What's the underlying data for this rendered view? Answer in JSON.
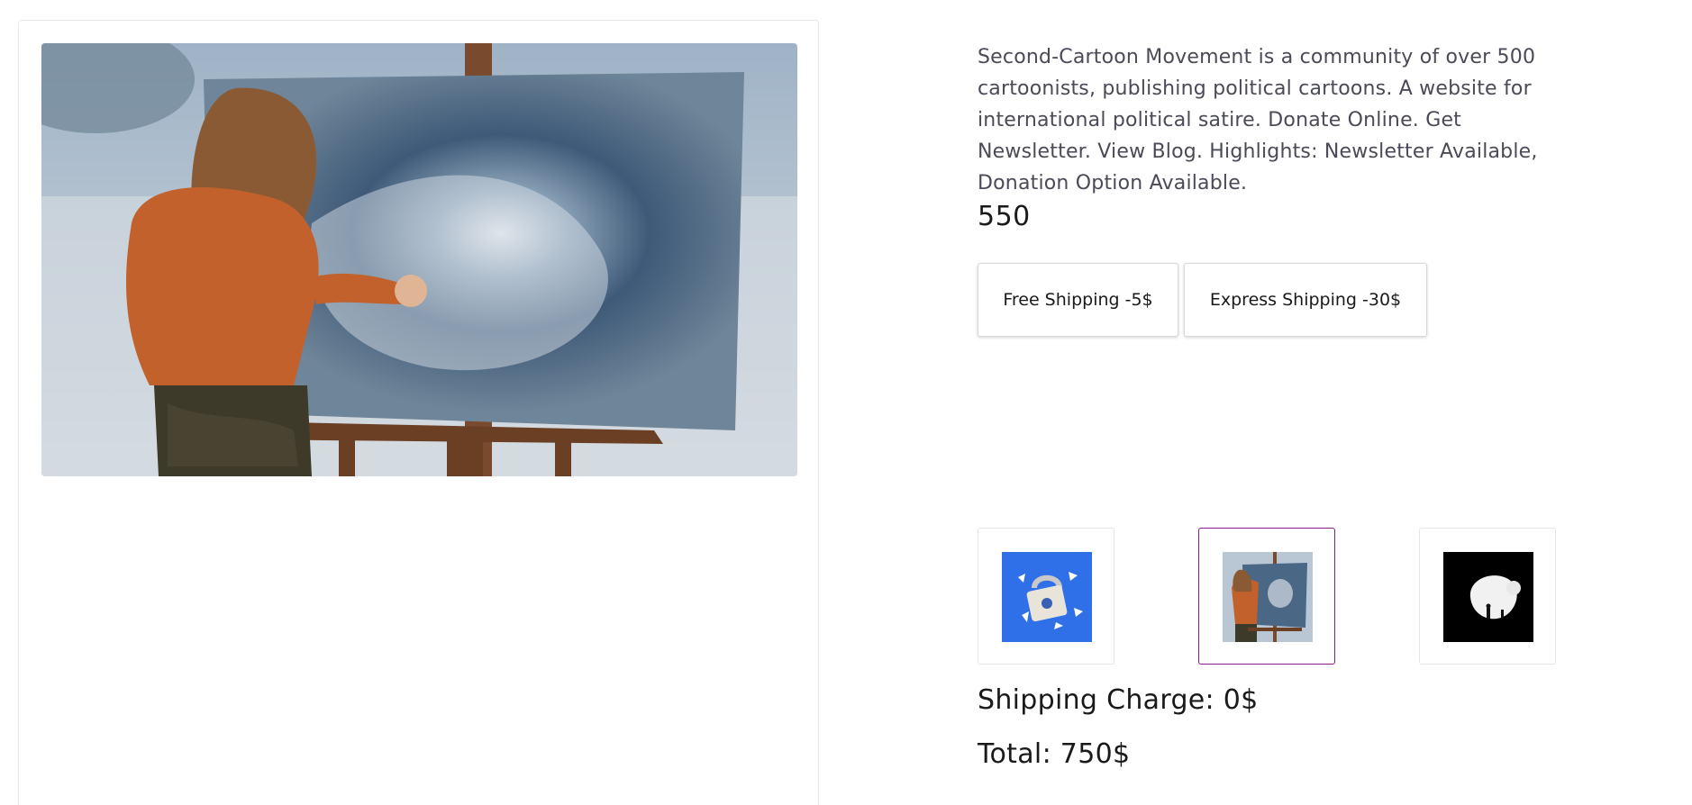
{
  "product": {
    "description": "Second-Cartoon Movement is a community of over 500 cartoonists, publishing political cartoons. A website for international political satire. Donate Online. Get Newsletter. View Blog. Highlights: Newsletter Available, Donation Option Available.",
    "price": "550",
    "main_image": "woman-painting-abstract-canvas-on-easel-by-sea"
  },
  "shipping": {
    "options": [
      {
        "label": "Free Shipping -5$"
      },
      {
        "label": "Express Shipping -30$"
      }
    ],
    "charge_text": "Shipping Charge: 0$",
    "total_text": "Total: 750$"
  },
  "thumbnails": [
    {
      "name": "blue-padlock-shattered",
      "selected": false
    },
    {
      "name": "woman-painting-easel",
      "selected": true
    },
    {
      "name": "white-sculpture-dark",
      "selected": false
    }
  ],
  "colors": {
    "selected_border": "#8a1c8a",
    "thumb_blue": "#2f6fe8"
  }
}
